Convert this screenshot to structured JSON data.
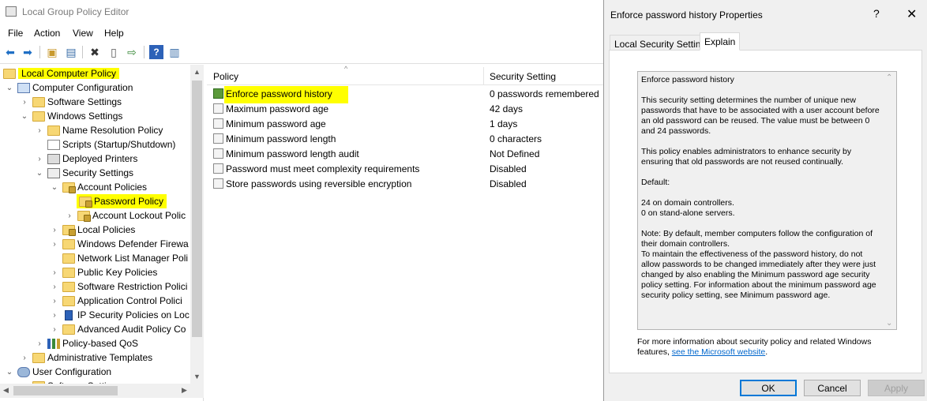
{
  "app": {
    "title": "Local Group Policy Editor"
  },
  "menu": [
    "File",
    "Action",
    "View",
    "Help"
  ],
  "tree": {
    "root": "Local Computer Policy",
    "computer_configuration": "Computer Configuration",
    "software_settings": "Software Settings",
    "windows_settings": "Windows Settings",
    "name_resolution_policy": "Name Resolution Policy",
    "scripts": "Scripts (Startup/Shutdown)",
    "deployed_printers": "Deployed Printers",
    "security_settings": "Security Settings",
    "account_policies": "Account Policies",
    "password_policy": "Password Policy",
    "account_lockout": "Account Lockout Polic",
    "local_policies": "Local Policies",
    "defender_firewall": "Windows Defender Firewa",
    "network_list": "Network List Manager Poli",
    "public_key": "Public Key Policies",
    "software_restriction": "Software Restriction Polici",
    "app_control": "Application Control Polici",
    "ip_security": "IP Security Policies on Loc",
    "advanced_audit": "Advanced Audit Policy Co",
    "qos": "Policy-based QoS",
    "admin_templates": "Administrative Templates",
    "user_configuration": "User Configuration",
    "software_settings_2": "Software Settings"
  },
  "list": {
    "col_policy": "Policy",
    "col_setting": "Security Setting",
    "rows": [
      {
        "name": "Enforce password history",
        "value": "0 passwords remembered"
      },
      {
        "name": "Maximum password age",
        "value": "42 days"
      },
      {
        "name": "Minimum password age",
        "value": "1 days"
      },
      {
        "name": "Minimum password length",
        "value": "0 characters"
      },
      {
        "name": "Minimum password length audit",
        "value": "Not Defined"
      },
      {
        "name": "Password must meet complexity requirements",
        "value": "Disabled"
      },
      {
        "name": "Store passwords using reversible encryption",
        "value": "Disabled"
      }
    ]
  },
  "dialog": {
    "title": "Enforce password history Properties",
    "help": "?",
    "close": "✕",
    "tab_local": "Local Security Setting",
    "tab_explain": "Explain",
    "explain_text": "Enforce password history\n\nThis security setting determines the number of unique new passwords that have to be associated with a user account before an old password can be reused. The value must be between 0 and 24 passwords.\n\nThis policy enables administrators to enhance security by ensuring that old passwords are not reused continually.\n\nDefault:\n\n24 on domain controllers.\n0 on stand-alone servers.\n\nNote: By default, member computers follow the configuration of their domain controllers.\nTo maintain the effectiveness of the password history, do not allow passwords to be changed immediately after they were just changed by also enabling the Minimum password age security policy setting. For information about the minimum password age security policy setting, see Minimum password age.",
    "footer_prefix": "For more information about security policy and related Windows features, ",
    "footer_link": "see the Microsoft website",
    "footer_suffix": ".",
    "ok": "OK",
    "cancel": "Cancel",
    "apply": "Apply"
  },
  "colors": {
    "highlight": "#ffff00",
    "link": "#0066cc",
    "accent": "#0078d7"
  }
}
